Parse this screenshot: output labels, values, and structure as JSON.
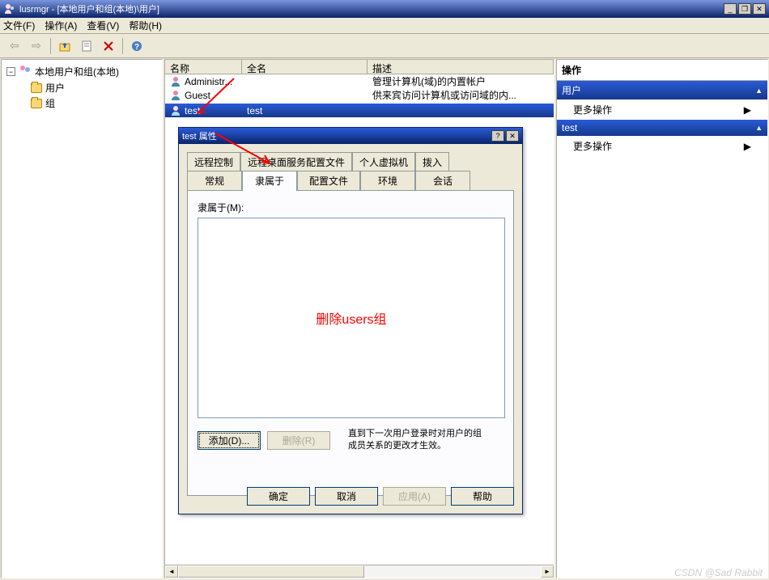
{
  "window": {
    "title": "lusrmgr - [本地用户和组(本地)\\用户]"
  },
  "menu": {
    "file": "文件(F)",
    "action": "操作(A)",
    "view": "查看(V)",
    "help": "帮助(H)"
  },
  "tree": {
    "root": "本地用户和组(本地)",
    "users": "用户",
    "groups": "组"
  },
  "list": {
    "col_name": "名称",
    "col_fullname": "全名",
    "col_desc": "描述",
    "rows": [
      {
        "name": "Administr...",
        "full": "",
        "desc": "管理计算机(域)的内置帐户"
      },
      {
        "name": "Guest",
        "full": "",
        "desc": "供来宾访问计算机或访问域的内..."
      },
      {
        "name": "test",
        "full": "test",
        "desc": ""
      }
    ]
  },
  "actions": {
    "title": "操作",
    "sec_user": "用户",
    "more1": "更多操作",
    "sec_sel": "test",
    "more2": "更多操作"
  },
  "dialog": {
    "title": "test 属性",
    "tabs_r1": [
      "远程控制",
      "远程桌面服务配置文件",
      "个人虚拟机",
      "拨入"
    ],
    "tabs_r2": [
      "常规",
      "隶属于",
      "配置文件",
      "环境",
      "会话"
    ],
    "active_tab": "隶属于",
    "member_label": "隶属于(M):",
    "annotation": "删除users组",
    "add_btn": "添加(D)...",
    "del_btn": "删除(R)",
    "hint_l1": "直到下一次用户登录时对用户的组",
    "hint_l2": "成员关系的更改才生效。",
    "ok": "确定",
    "cancel": "取消",
    "apply": "应用(A)",
    "help": "帮助"
  },
  "watermark": "CSDN @Sad Rabbit"
}
